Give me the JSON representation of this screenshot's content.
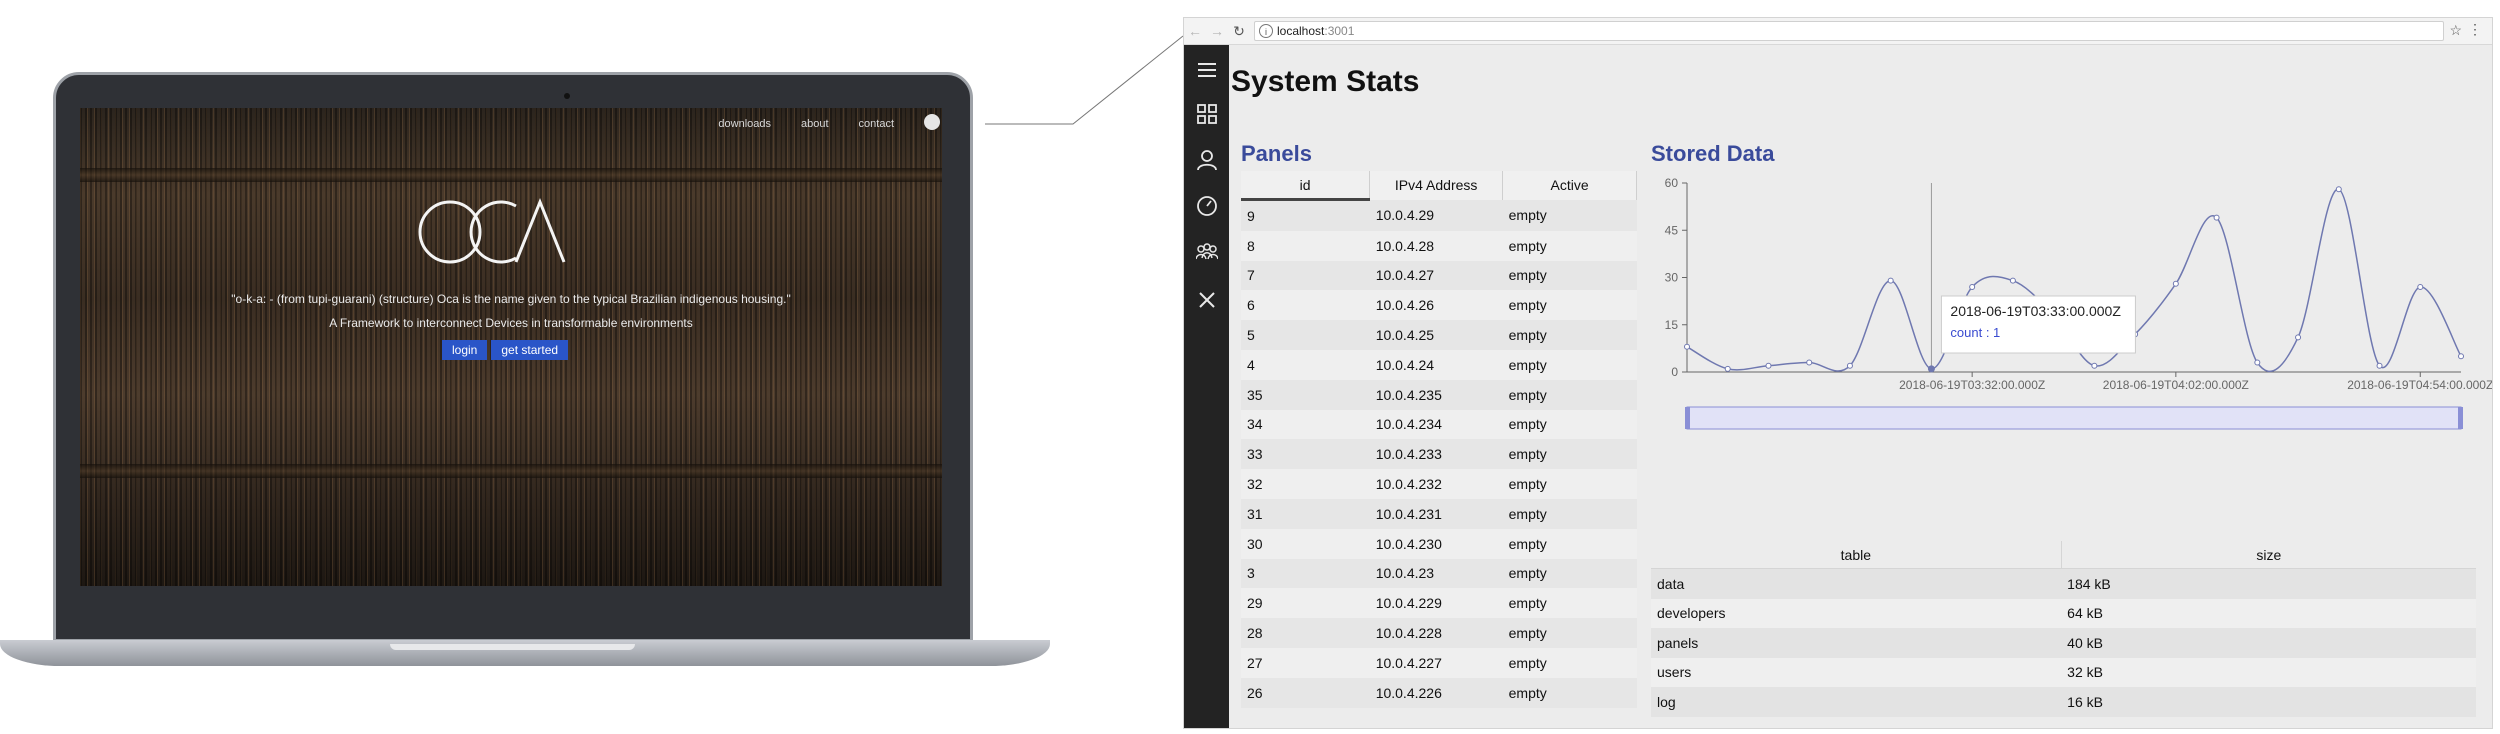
{
  "landing": {
    "nav": [
      "downloads",
      "about",
      "contact"
    ],
    "logo_text": "OCA",
    "quote": "\"o-k-a: - (from tupi-guarani) (structure) Oca is the name given to the typical Brazilian indigenous housing.\"",
    "subtitle": "A Framework to interconnect Devices in transformable environments",
    "buttons": [
      "login",
      "get started"
    ]
  },
  "browser": {
    "url_host": "localhost",
    "url_port": ":3001"
  },
  "sidebar": {
    "icons": [
      "menu-icon",
      "dashboard-grid-icon",
      "user-icon",
      "gauge-icon",
      "group-icon",
      "close-icon"
    ]
  },
  "page": {
    "title": "System Stats"
  },
  "panels": {
    "title": "Panels",
    "columns": [
      "id",
      "IPv4 Address",
      "Active"
    ],
    "rows": [
      [
        "9",
        "10.0.4.29",
        "empty"
      ],
      [
        "8",
        "10.0.4.28",
        "empty"
      ],
      [
        "7",
        "10.0.4.27",
        "empty"
      ],
      [
        "6",
        "10.0.4.26",
        "empty"
      ],
      [
        "5",
        "10.0.4.25",
        "empty"
      ],
      [
        "4",
        "10.0.4.24",
        "empty"
      ],
      [
        "35",
        "10.0.4.235",
        "empty"
      ],
      [
        "34",
        "10.0.4.234",
        "empty"
      ],
      [
        "33",
        "10.0.4.233",
        "empty"
      ],
      [
        "32",
        "10.0.4.232",
        "empty"
      ],
      [
        "31",
        "10.0.4.231",
        "empty"
      ],
      [
        "30",
        "10.0.4.230",
        "empty"
      ],
      [
        "3",
        "10.0.4.23",
        "empty"
      ],
      [
        "29",
        "10.0.4.229",
        "empty"
      ],
      [
        "28",
        "10.0.4.228",
        "empty"
      ],
      [
        "27",
        "10.0.4.227",
        "empty"
      ],
      [
        "26",
        "10.0.4.226",
        "empty"
      ]
    ]
  },
  "stored": {
    "title": "Stored Data",
    "columns": [
      "table",
      "size"
    ],
    "rows": [
      [
        "data",
        "184 kB"
      ],
      [
        "developers",
        "64 kB"
      ],
      [
        "panels",
        "40 kB"
      ],
      [
        "users",
        "32 kB"
      ],
      [
        "log",
        "16 kB"
      ]
    ]
  },
  "chart_data": {
    "type": "line",
    "title": "",
    "xlabel": "",
    "ylabel": "",
    "ylim": [
      0,
      60
    ],
    "yticks": [
      0,
      15,
      30,
      45,
      60
    ],
    "xtick_labels": [
      "2018-06-19T03:32:00.000Z",
      "2018-06-19T04:02:00.000Z",
      "2018-06-19T04:54:00.000Z"
    ],
    "xtick_index": [
      7,
      12,
      18
    ],
    "series": [
      {
        "values": [
          8,
          1,
          2,
          3,
          2,
          29,
          1,
          27,
          29,
          18,
          2,
          12,
          28,
          49,
          3,
          11,
          58,
          2,
          27,
          5
        ]
      }
    ],
    "tooltip": {
      "title": "2018-06-19T03:33:00.000Z",
      "label": "count : 1",
      "index": 6
    },
    "colors": {
      "line": "#6f78b0",
      "brush": "#8a8fd6"
    }
  }
}
